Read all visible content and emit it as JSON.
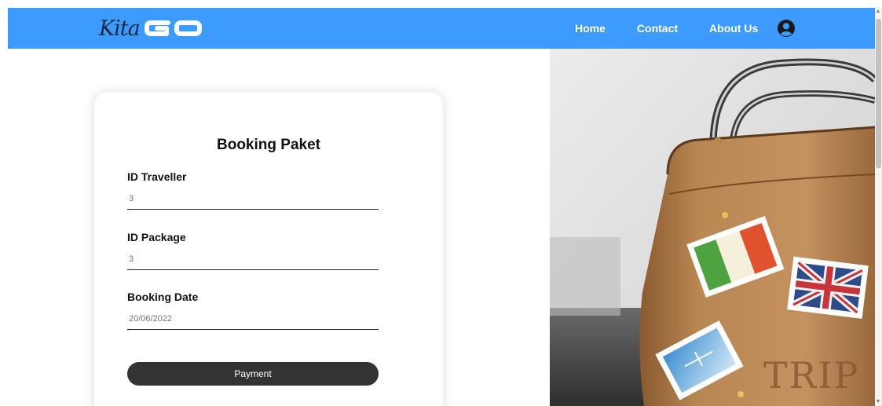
{
  "header": {
    "logo": {
      "script_text": "Kita",
      "logo_text": "GO"
    },
    "nav": {
      "home": "Home",
      "contact": "Contact",
      "about": "About Us"
    },
    "user_icon": "user-circle-icon",
    "background_color": "#3d9bff"
  },
  "form": {
    "title": "Booking Paket",
    "fields": [
      {
        "label": "ID Traveller",
        "value": "3"
      },
      {
        "label": "ID Package",
        "value": "3"
      },
      {
        "label": "Booking Date",
        "value": "20/06/2022"
      }
    ],
    "submit_label": "Payment"
  },
  "hero_image": {
    "stamp_text": "TRIP"
  }
}
